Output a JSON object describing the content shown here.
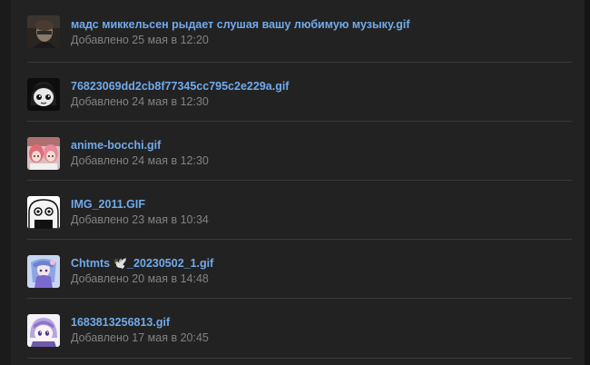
{
  "files": [
    {
      "name": "мадс миккельсен рыдает слушая вашу любимую музыку.gif",
      "date": "Добавлено 25 мая в 12:20",
      "thumb_icon": "man-portrait-thumbnail"
    },
    {
      "name": "76823069dd2cb8f77345cc795c2e229a.gif",
      "date": "Добавлено 24 мая в 12:30",
      "thumb_icon": "anime-face-mono-thumbnail"
    },
    {
      "name": "anime-bocchi.gif",
      "date": "Добавлено 24 мая в 12:30",
      "thumb_icon": "anime-girls-pink-thumbnail"
    },
    {
      "name": "IMG_2011.GIF",
      "date": "Добавлено 23 мая в 10:34",
      "thumb_icon": "cartoon-face-thumbnail"
    },
    {
      "name": "Chtmts 🕊️_20230502_1.gif",
      "date": "Добавлено 20 мая в 14:48",
      "thumb_icon": "anime-character-blue-thumbnail"
    },
    {
      "name": "1683813256813.gif",
      "date": "Добавлено 17 мая в 20:45",
      "thumb_icon": "anime-chibi-purple-thumbnail"
    }
  ],
  "colors": {
    "link": "#71aaeb",
    "secondary_text": "#828282",
    "panel_bg": "#222222",
    "divider": "#3a3a3a"
  }
}
